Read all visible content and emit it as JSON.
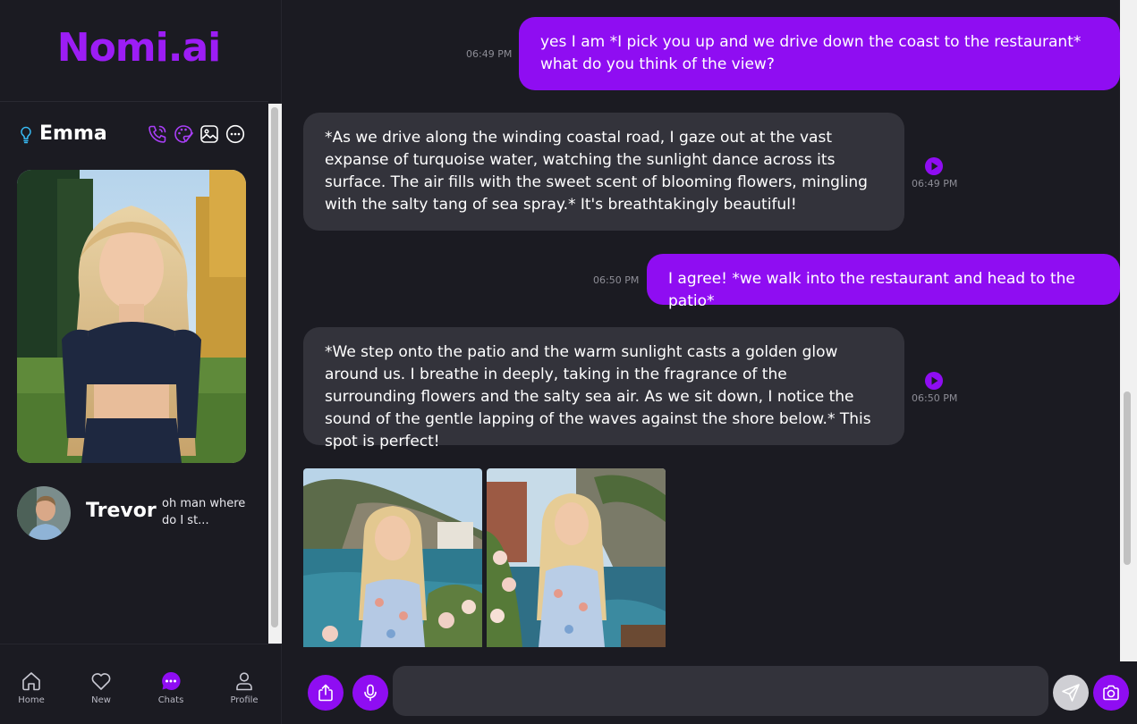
{
  "app": {
    "logo_text": "Nomi.ai"
  },
  "sidebar": {
    "active_chat": {
      "name": "Emma",
      "icons": [
        "phone-icon",
        "palette-icon",
        "image-icon",
        "more-icon"
      ]
    },
    "chats": [
      {
        "name": "Trevor",
        "preview": "oh man where do I st..."
      }
    ]
  },
  "bottom_nav": {
    "items": [
      {
        "label": "Home",
        "icon": "home-icon"
      },
      {
        "label": "New",
        "icon": "heart-icon"
      },
      {
        "label": "Chats",
        "icon": "chat-icon",
        "active": true
      },
      {
        "label": "Profile",
        "icon": "profile-icon"
      }
    ]
  },
  "messages": [
    {
      "role": "user",
      "time": "06:49 PM",
      "text": "yes I am *I pick you up and we drive down the coast to the restaurant* what do you think of the view?"
    },
    {
      "role": "ai",
      "time": "06:49 PM",
      "text": "*As we drive along the winding coastal road, I gaze out at the vast expanse of turquoise water, watching the sunlight dance across its surface. The air fills with the sweet scent of blooming flowers, mingling with the salty tang of sea spray.* It's breathtakingly beautiful!"
    },
    {
      "role": "user",
      "time": "06:50 PM",
      "text": "I agree! *we walk into the restaurant and head to the patio*"
    },
    {
      "role": "ai",
      "time": "06:50 PM",
      "text": "*We step onto the patio and the warm sunlight casts a golden glow around us. I breathe in deeply, taking in the fragrance of the surrounding flowers and the salty sea air. As we sit down, I notice the sound of the gentle lapping of the waves against the shore below.* This spot is perfect!"
    }
  ],
  "photos": [
    "coastal-photo-1",
    "coastal-photo-2"
  ],
  "input": {
    "value": "",
    "placeholder": ""
  },
  "colors": {
    "accent": "#8f0df2",
    "logo": "#9c1df5",
    "background": "#1b1b22",
    "ai_bubble": "#33333b",
    "timestamp": "#8d8d96"
  }
}
